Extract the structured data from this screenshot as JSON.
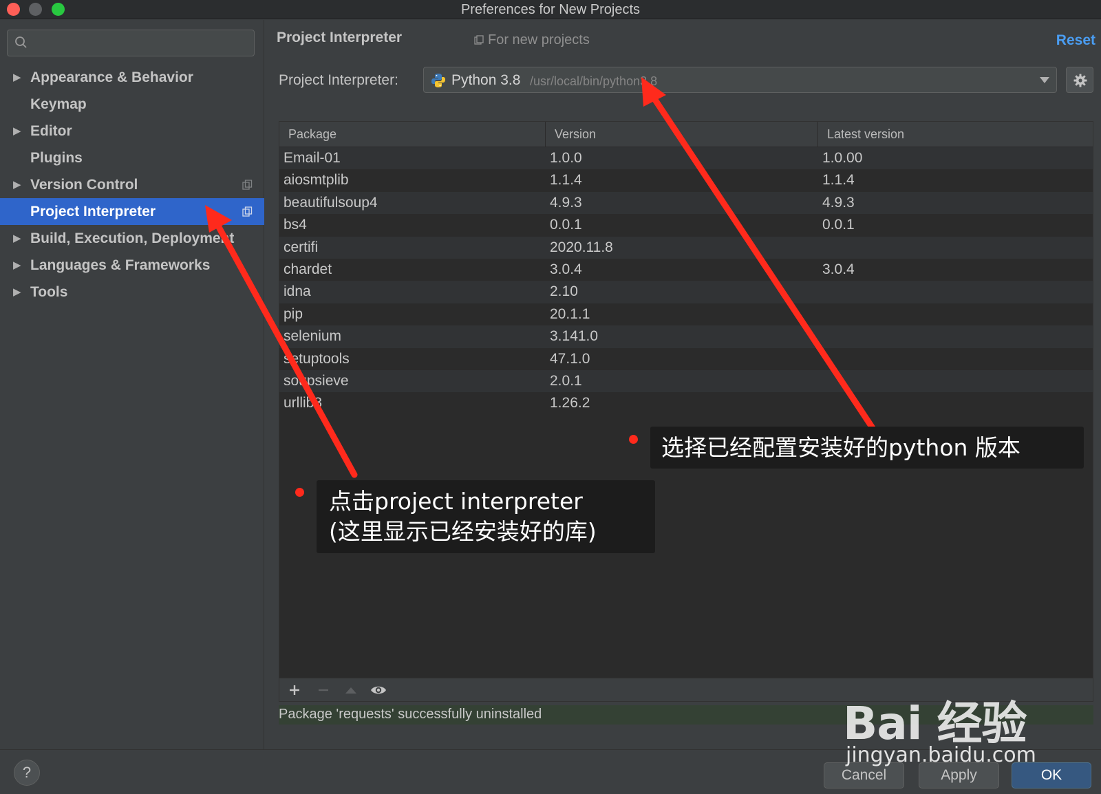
{
  "window": {
    "title": "Preferences for New Projects"
  },
  "sidebar": {
    "search_placeholder": "",
    "items": [
      {
        "label": "Appearance & Behavior",
        "expandable": true
      },
      {
        "label": "Keymap",
        "expandable": false
      },
      {
        "label": "Editor",
        "expandable": true
      },
      {
        "label": "Plugins",
        "expandable": false
      },
      {
        "label": "Version Control",
        "expandable": true
      },
      {
        "label": "Project Interpreter",
        "expandable": false,
        "selected": true
      },
      {
        "label": "Build, Execution, Deployment",
        "expandable": true
      },
      {
        "label": "Languages & Frameworks",
        "expandable": true
      },
      {
        "label": "Tools",
        "expandable": true
      }
    ],
    "expand_glyph": "▶"
  },
  "main": {
    "title": "Project Interpreter",
    "scope_label": "For new projects",
    "reset_label": "Reset",
    "interpreter_label": "Project Interpreter:",
    "interpreter_name": "Python 3.8",
    "interpreter_path": "/usr/local/bin/python3.8",
    "packages_table": {
      "headers": [
        "Package",
        "Version",
        "Latest version"
      ],
      "rows": [
        [
          "Email-01",
          "1.0.0",
          "1.0.00"
        ],
        [
          "aiosmtplib",
          "1.1.4",
          "1.1.4"
        ],
        [
          "beautifulsoup4",
          "4.9.3",
          "4.9.3"
        ],
        [
          "bs4",
          "0.0.1",
          "0.0.1"
        ],
        [
          "certifi",
          "2020.11.8",
          ""
        ],
        [
          "chardet",
          "3.0.4",
          "3.0.4"
        ],
        [
          "idna",
          "2.10",
          ""
        ],
        [
          "pip",
          "20.1.1",
          ""
        ],
        [
          "selenium",
          "3.141.0",
          ""
        ],
        [
          "setuptools",
          "47.1.0",
          ""
        ],
        [
          "soupsieve",
          "2.0.1",
          ""
        ],
        [
          "urllib3",
          "1.26.2",
          ""
        ]
      ]
    },
    "status_message": "Package 'requests' successfully uninstalled"
  },
  "footer": {
    "help_label": "?",
    "cancel_label": "Cancel",
    "apply_label": "Apply",
    "ok_label": "OK"
  },
  "annotations": {
    "callout_interpreter": "选择已经配置安装好的python 版本",
    "callout_sidebar_line1": "点击project interpreter",
    "callout_sidebar_line2": "(这里显示已经安装好的库)"
  },
  "watermark": {
    "logo_text": "Bai 经验",
    "url": "jingyan.baidu.com"
  },
  "colors": {
    "background": "#3c3f41",
    "selection": "#2f65ca",
    "link": "#4a9df2",
    "annotation_arrow": "#ff2a1c",
    "ok_button": "#365880",
    "status_bg": "#344134"
  },
  "icons": [
    "search-icon",
    "copy-settings-icon",
    "python-icon",
    "chevron-down-icon",
    "gear-icon",
    "add-icon",
    "remove-icon",
    "upgrade-icon",
    "eye-icon"
  ]
}
